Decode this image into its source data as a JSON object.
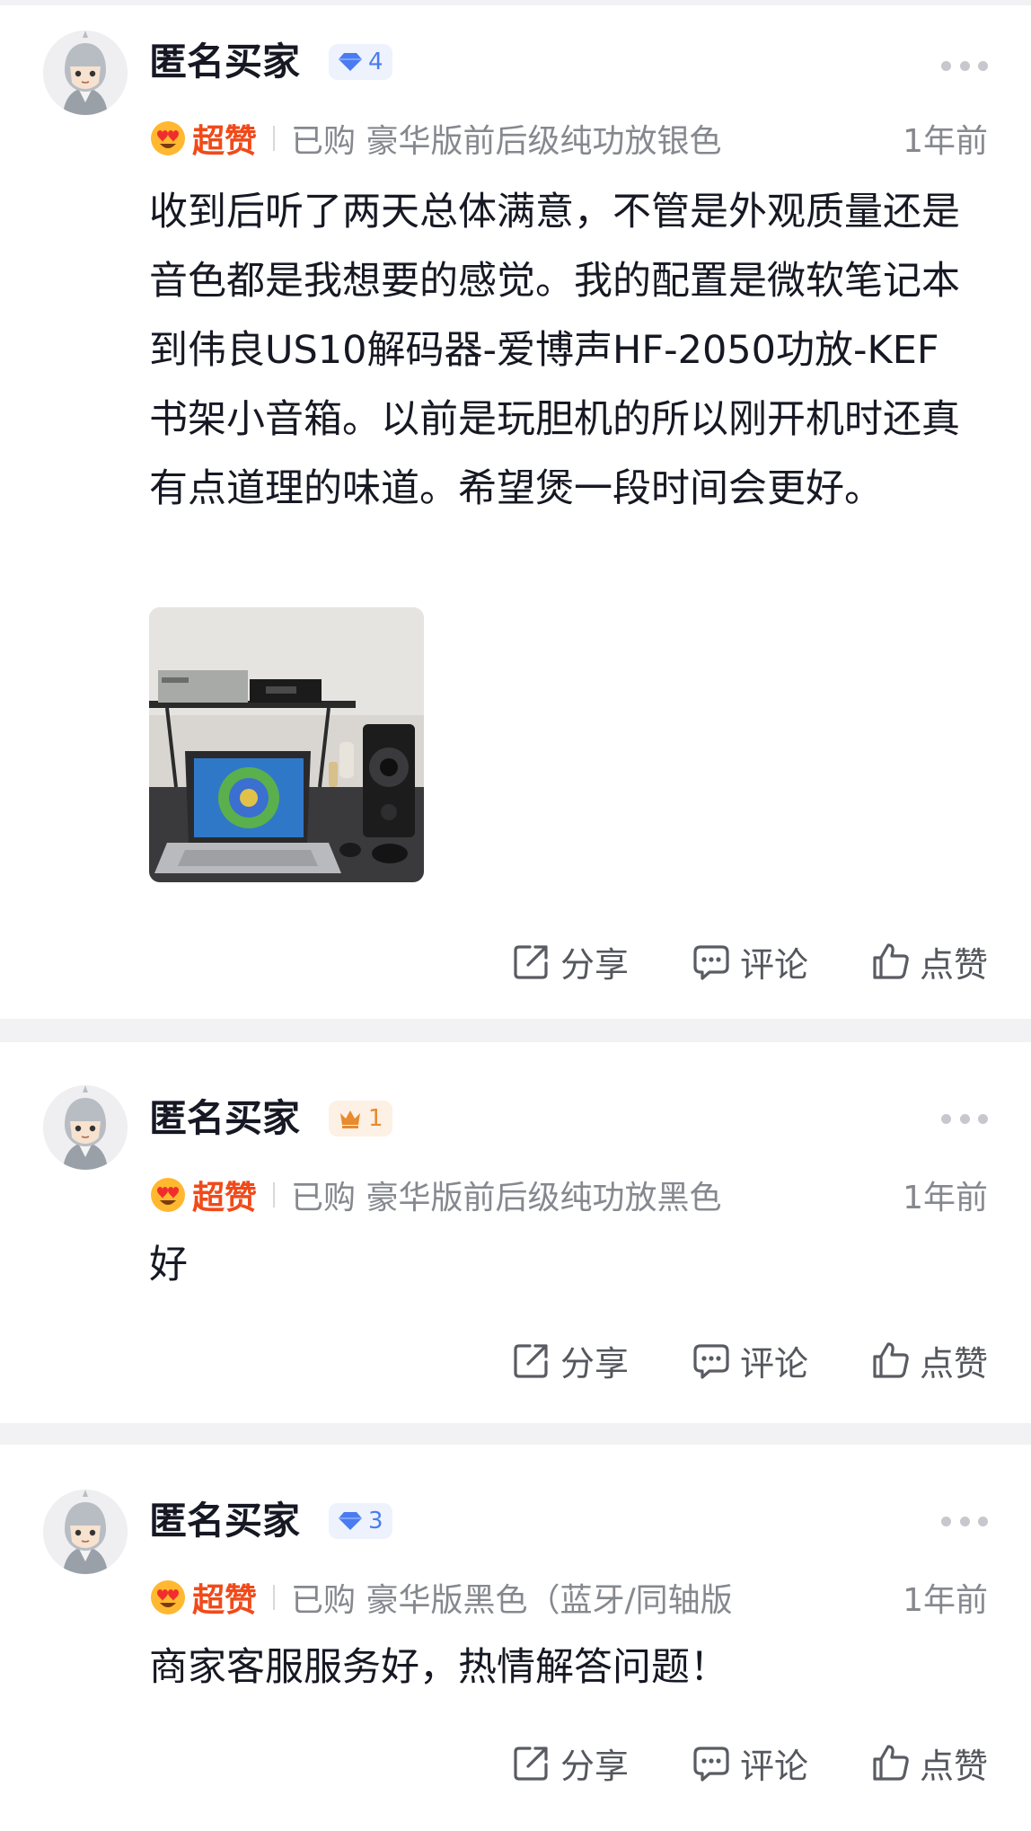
{
  "reviews": [
    {
      "username": "匿名买家",
      "level": "4",
      "rating_label": "超赞",
      "purchase": "已购 豪华版前后级纯功放银色",
      "time": "1年前",
      "text": "收到后听了两天总体满意，不管是外观质量还是音色都是我想要的感觉。我的配置是微软笔记本到伟良US10解码器-爱博声HF-2050功放-KEF书架小音箱。以前是玩胆机的所以刚开机时还真有点道理的味道。希望煲一段时间会更好。",
      "level_icon": "diamond-icon",
      "actions": {
        "share": "分享",
        "comment": "评论",
        "like": "点赞"
      }
    },
    {
      "username": "匿名买家",
      "level": "1",
      "rating_label": "超赞",
      "purchase": "已购 豪华版前后级纯功放黑色",
      "time": "1年前",
      "text": "好",
      "level_icon": "crown-icon",
      "actions": {
        "share": "分享",
        "comment": "评论",
        "like": "点赞"
      }
    },
    {
      "username": "匿名买家",
      "level": "3",
      "rating_label": "超赞",
      "purchase": "已购 豪华版黑色（蓝牙/同轴版",
      "time": "1年前",
      "text": "商家客服服务好，热情解答问题！",
      "level_icon": "diamond-icon",
      "actions": {
        "share": "分享",
        "comment": "评论",
        "like": "点赞"
      }
    }
  ],
  "colors": {
    "rating_accent": "#f04a1a",
    "meta_gray": "#86888f",
    "diamond_badge": "#4a7cf0",
    "crown_badge": "#e88a2e",
    "page_background": "#f2f2f4"
  }
}
